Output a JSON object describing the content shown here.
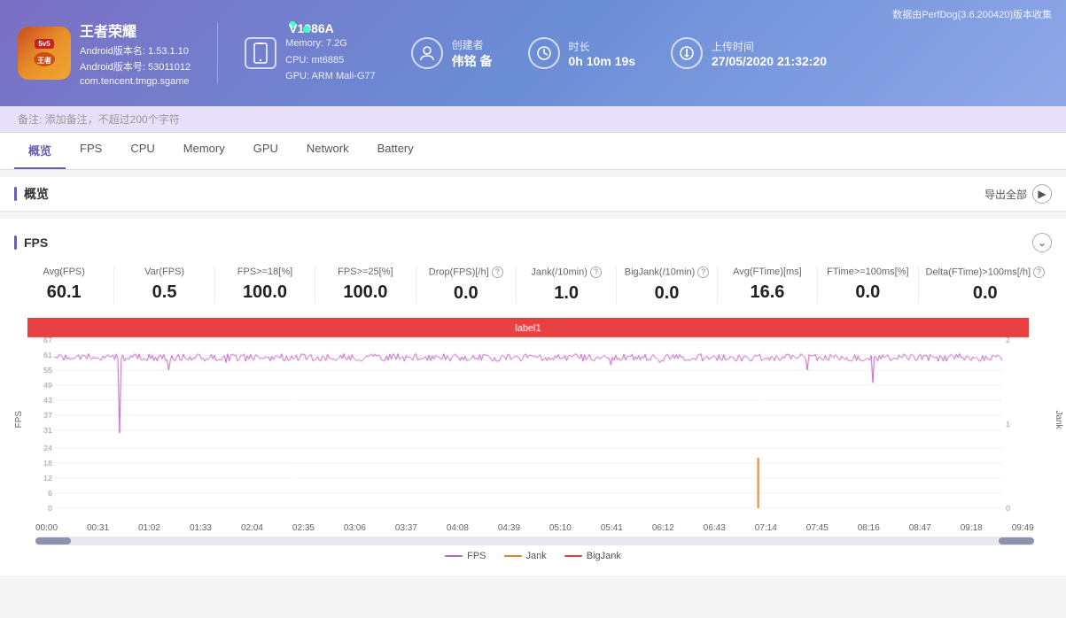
{
  "header": {
    "perfdog_label": "数据由PerfDog(3.6.200420)版本收集",
    "app": {
      "name": "王者荣耀",
      "android_version": "Android版本名: 1.53.1.10",
      "android_id": "Android版本号: 53011012",
      "package": "com.tencent.tmgp.sgame"
    },
    "device": {
      "name": "V1986A",
      "online": true,
      "memory": "Memory: 7.2G",
      "cpu": "CPU: mt6885",
      "gpu": "GPU: ARM Mali-G77"
    },
    "creator": {
      "label": "创建者",
      "value": "伟铭 备"
    },
    "duration": {
      "label": "时长",
      "value": "0h 10m 19s"
    },
    "upload_time": {
      "label": "上传时间",
      "value": "27/05/2020 21:32:20"
    },
    "note_placeholder": "备注: 添加备注，不超过200个字符"
  },
  "nav": {
    "tabs": [
      "概览",
      "FPS",
      "CPU",
      "Memory",
      "GPU",
      "Network",
      "Battery"
    ],
    "active": "概览"
  },
  "overview": {
    "section_title": "概览",
    "export_label": "导出全部"
  },
  "fps_section": {
    "title": "FPS",
    "chart_label": "FPS",
    "jank_label": "Jank",
    "label1": "label1",
    "stats": [
      {
        "name": "Avg(FPS)",
        "value": "60.1"
      },
      {
        "name": "Var(FPS)",
        "value": "0.5"
      },
      {
        "name": "FPS>=18[%]",
        "value": "100.0"
      },
      {
        "name": "FPS>=25[%]",
        "value": "100.0"
      },
      {
        "name": "Drop(FPS)[/h]",
        "value": "0.0",
        "help": true
      },
      {
        "name": "Jank(/10min)",
        "value": "1.0",
        "help": true
      },
      {
        "name": "BigJank(/10min)",
        "value": "0.0",
        "help": true
      },
      {
        "name": "Avg(FTime)[ms]",
        "value": "16.6"
      },
      {
        "name": "FTime>=100ms[%]",
        "value": "0.0"
      },
      {
        "name": "Delta(FTime)>100ms[/h]",
        "value": "0.0",
        "help": true
      }
    ],
    "x_ticks": [
      "00:00",
      "00:31",
      "01:02",
      "01:33",
      "02:04",
      "02:35",
      "03:06",
      "03:37",
      "04:08",
      "04:39",
      "05:10",
      "05:41",
      "06:12",
      "06:43",
      "07:14",
      "07:45",
      "08:16",
      "08:47",
      "09:18",
      "09:49"
    ],
    "legend": [
      {
        "name": "FPS",
        "color": "#c060c0"
      },
      {
        "name": "Jank",
        "color": "#e0822a"
      },
      {
        "name": "BigJank",
        "color": "#e04040"
      }
    ]
  }
}
